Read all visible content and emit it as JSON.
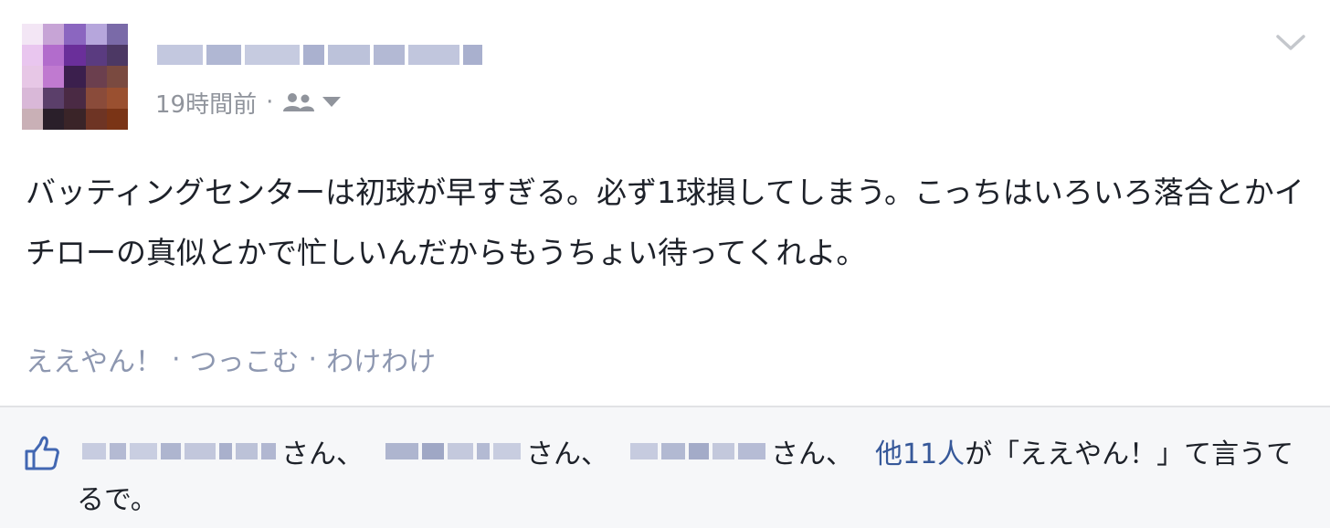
{
  "post": {
    "timestamp": "19時間前",
    "separator": "·",
    "audience_icon": "friends-icon",
    "text": "バッティングセンターは初球が早すぎる。必ず1球損してしまう。こっちはいろいろ落合とかイチローの真似とかで忙しいんだからもうちょい待ってくれよ。",
    "actions": [
      {
        "label": "ええやん！"
      },
      {
        "label": "つっこむ"
      },
      {
        "label": "わけわけ"
      }
    ],
    "action_separator": "·"
  },
  "likes": {
    "suffix_1": "さん、",
    "suffix_2": "さん、",
    "suffix_3": "さん、",
    "others": "他11人",
    "tail_line1": "が「ええやん！」て言うて",
    "tail_line2": "るで。"
  },
  "colors": {
    "meta_gray": "#90949c",
    "action_gray": "#8d97b0",
    "link_blue": "#365899",
    "like_icon": "#4267b2",
    "bar_bg": "#f6f7f9"
  }
}
